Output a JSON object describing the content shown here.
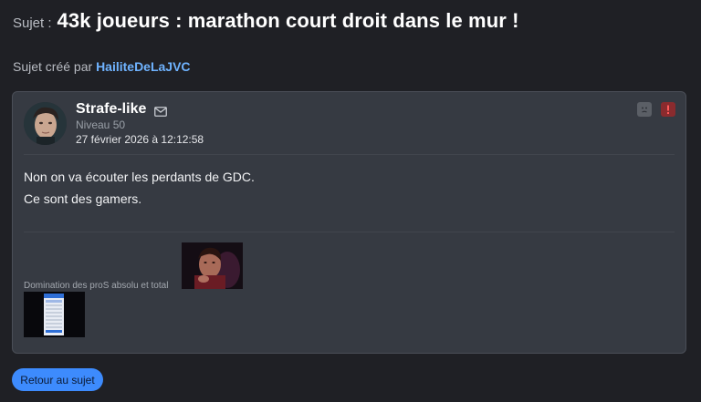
{
  "topic": {
    "prefix": "Sujet :",
    "title": "43k joueurs : marathon court droit dans le mur !",
    "creator_prefix": "Sujet créé par",
    "creator_name": "HailiteDeLaJVC"
  },
  "post": {
    "author": "Strafe-like",
    "level": "Niveau 50",
    "date": "27 février 2026 à 12:12:58",
    "message_lines": [
      "Non on va écouter les perdants de GDC.",
      "Ce sont des gamers."
    ],
    "signature_text": "Domination des proS absolu et total",
    "icons": {
      "mail": "mail-icon",
      "sad": "sad-face-icon",
      "alert": "alert-icon"
    }
  },
  "footer": {
    "back_button": "Retour au sujet"
  },
  "colors": {
    "background": "#1f2025",
    "card": "#363a42",
    "link": "#6fb3ff",
    "button": "#3d8bfd",
    "alert": "#8a2b2e"
  }
}
